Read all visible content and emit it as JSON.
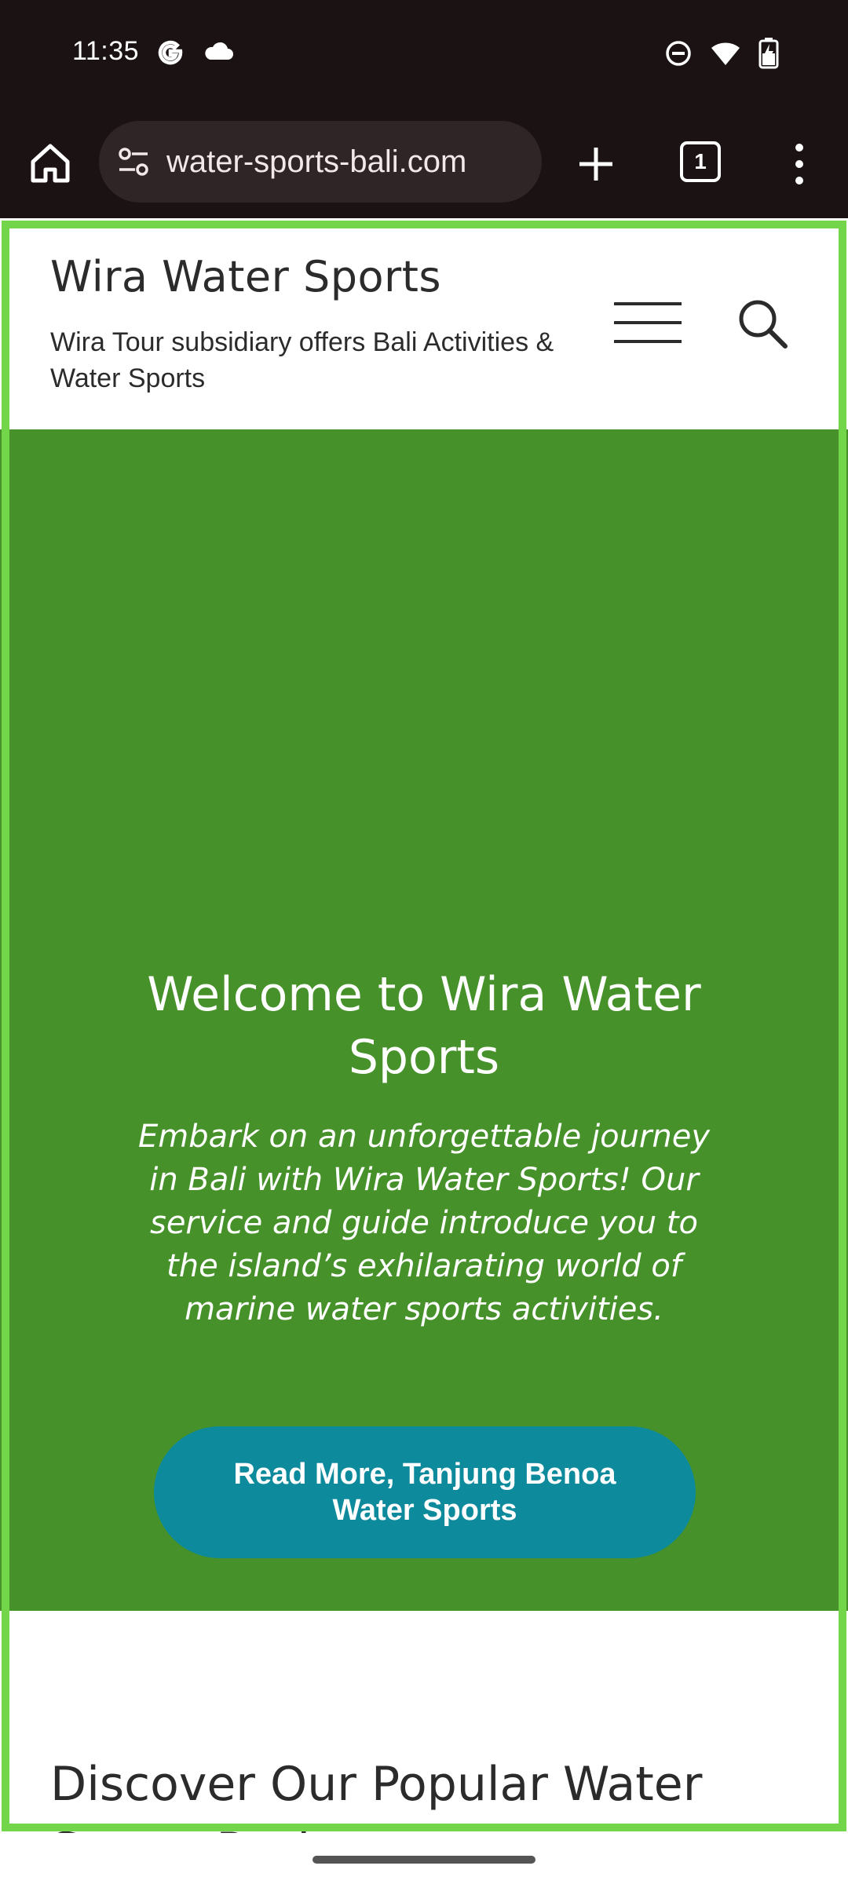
{
  "status_bar": {
    "time": "11:35",
    "left_icons": [
      "google-icon",
      "cloud-icon"
    ],
    "right_icons": [
      "do-not-disturb-icon",
      "wifi-icon",
      "battery-icon"
    ]
  },
  "browser": {
    "url": "water-sports-bali.com",
    "tab_count": "1",
    "icons": [
      "home-icon",
      "site-settings-icon",
      "new-tab-icon",
      "tabs-icon",
      "more-options-icon"
    ]
  },
  "header": {
    "site_title": "Wira Water Sports",
    "tagline": "Wira Tour subsidiary offers Bali Activities & Water Sports",
    "icons": [
      "hamburger-menu-icon",
      "search-icon"
    ]
  },
  "hero": {
    "title": "Welcome to Wira Water Sports",
    "text": "Embark on an unforgettable journey in Bali with Wira Water Sports! Our service and guide introduce you to the island’s exhilarating world of marine water sports activities.",
    "button_label": "Read More, Tanjung Benoa Water Sports",
    "background_color": "#46912a",
    "button_color": "#0d8a9c"
  },
  "section": {
    "heading": "Discover Our Popular Water Sports Packages"
  }
}
